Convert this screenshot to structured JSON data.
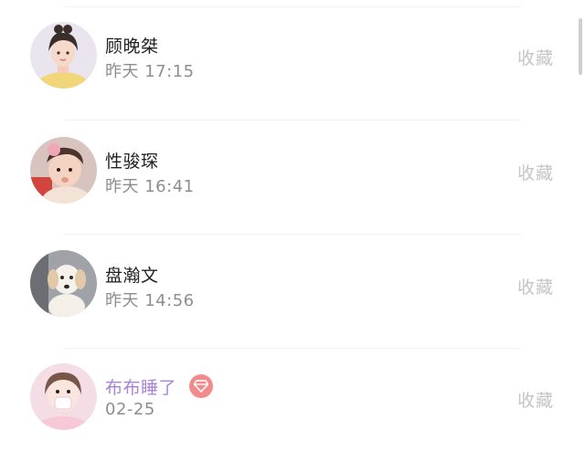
{
  "contacts": [
    {
      "name": "顾晚桀",
      "time": "昨天 17:15",
      "action": "收藏",
      "avatar": "girl-portrait",
      "vip": false
    },
    {
      "name": "性骏琛",
      "time": "昨天 16:41",
      "action": "收藏",
      "avatar": "baby-portrait",
      "vip": false
    },
    {
      "name": "盘瀚文",
      "time": "昨天 14:56",
      "action": "收藏",
      "avatar": "puppy-photo",
      "vip": false
    },
    {
      "name": "布布睡了",
      "time": "02-25",
      "action": "收藏",
      "avatar": "girl-mask-portrait",
      "vip": true,
      "vip_badge_icon": "diamond-icon"
    }
  ],
  "colors": {
    "name_text": "#222222",
    "vip_name_text": "#a883d6",
    "time_text": "#8e8e8e",
    "action_text": "#c5c5c5",
    "vip_badge": "#f28b8b",
    "divider": "#f1f1f1"
  }
}
